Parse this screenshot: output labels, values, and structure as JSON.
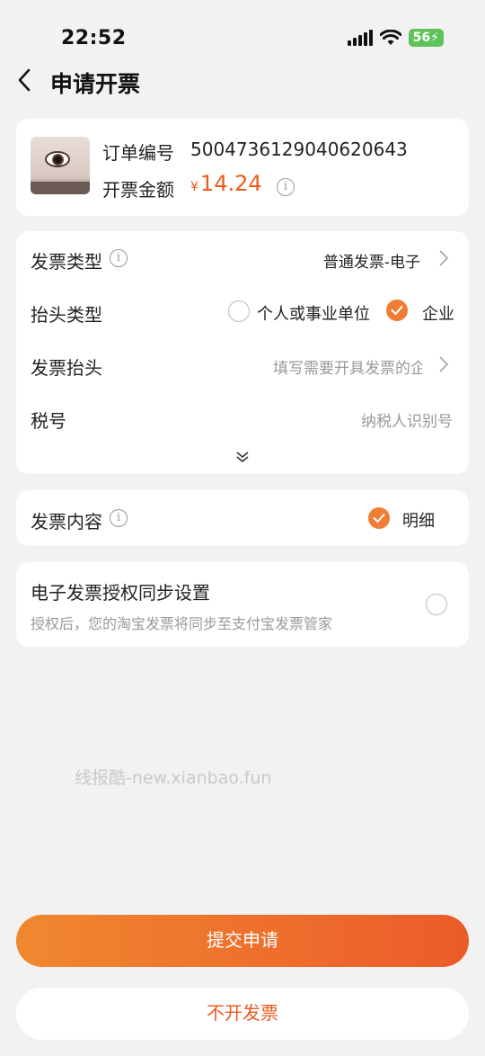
{
  "status": {
    "time": "22:52",
    "battery": "56"
  },
  "nav": {
    "title": "申请开票"
  },
  "order": {
    "number_label": "订单编号",
    "number": "5004736129040620643",
    "amount_label": "开票金额",
    "currency": "¥",
    "amount": "14.24"
  },
  "form": {
    "invoice_type_label": "发票类型",
    "invoice_type_value": "普通发票-电子",
    "header_type_label": "抬头类型",
    "header_type_options": [
      "个人或事业单位",
      "企业"
    ],
    "header_type_selected": "企业",
    "invoice_header_label": "发票抬头",
    "invoice_header_placeholder": "填写需要开具发票的企业名称",
    "tax_no_label": "税号",
    "tax_no_placeholder": "纳税人识别号"
  },
  "content": {
    "label": "发票内容",
    "option": "明细"
  },
  "auth": {
    "title": "电子发票授权同步设置",
    "desc": "授权后，您的淘宝发票将同步至支付宝发票管家"
  },
  "watermark": "线报酷-new.xianbao.fun",
  "actions": {
    "submit": "提交申请",
    "no_invoice": "不开发票"
  },
  "colors": {
    "accent": "#ef7d35",
    "price": "#ee5a19",
    "background": "#f2f2f2"
  }
}
